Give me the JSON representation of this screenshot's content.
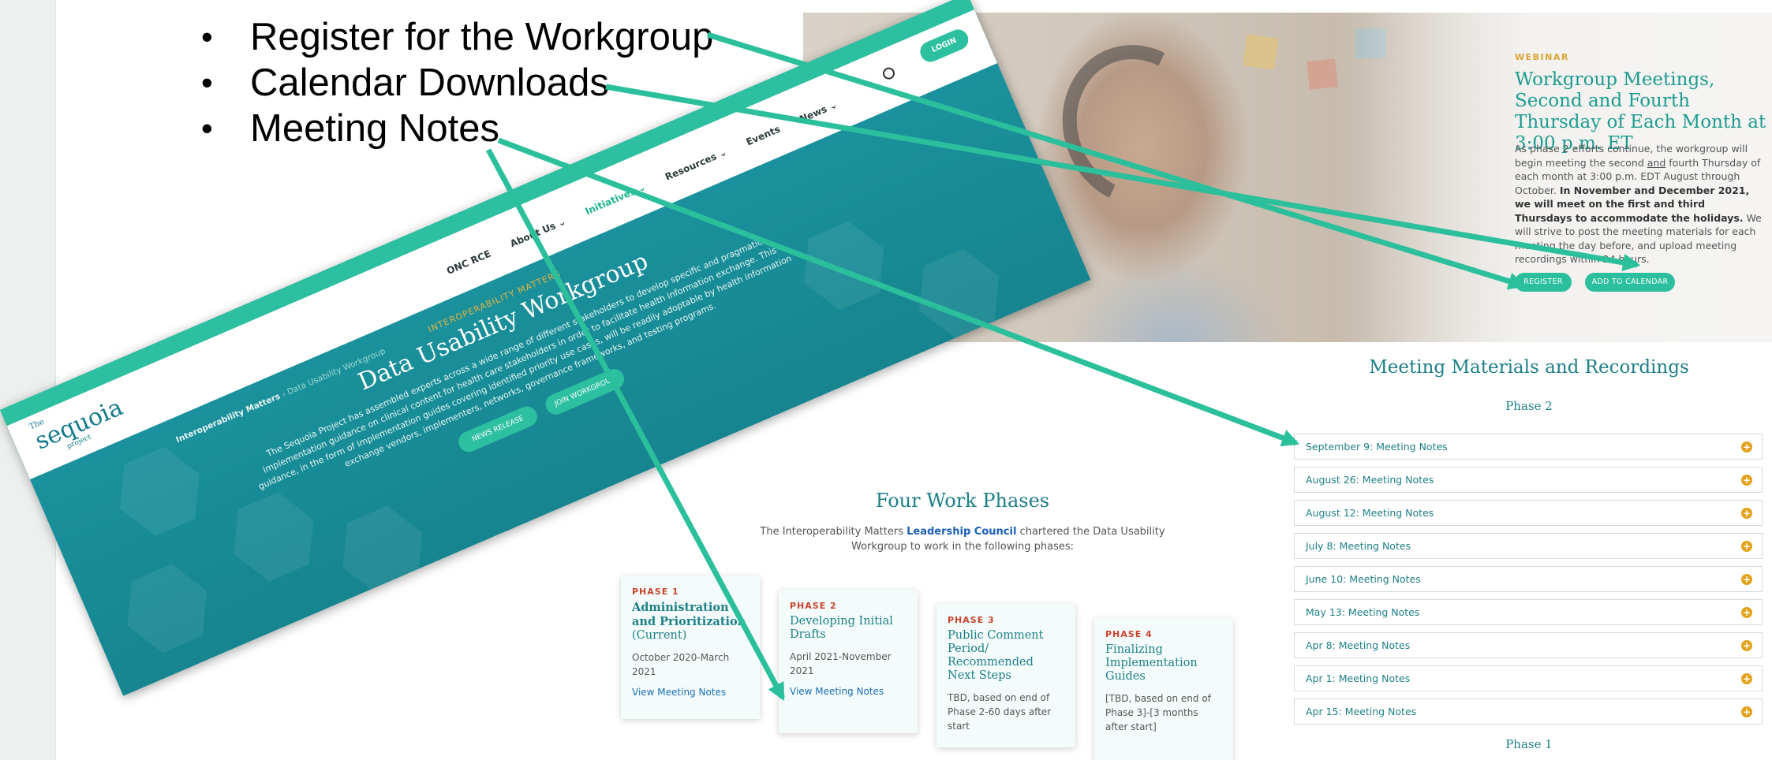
{
  "bullets": [
    "Register for the Workgroup",
    "Calendar Downloads",
    "Meeting Notes"
  ],
  "bullet_symbol": "•",
  "webinar": {
    "kicker": "WEBINAR",
    "title": "Workgroup Meetings, Second and Fourth Thursday of Each Month at 3:00 p.m. ET",
    "body_1": "As phase 2 efforts continue, the workgroup will begin meeting the second ",
    "body_and": "and",
    "body_2": " fourth Thursday of each month at 3:00 p.m. EDT August through October. ",
    "body_bold": "In November and December 2021, we will meet on the first and third Thursdays to accommodate the holidays.",
    "body_3": " We will strive to post the meeting materials for each meeting the day before, and upload meeting recordings within 24 hours.",
    "register_label": "REGISTER",
    "calendar_label": "ADD TO CALENDAR"
  },
  "materials": {
    "title": "Meeting Materials and Recordings",
    "phase2_label": "Phase 2",
    "phase1_label": "Phase 1",
    "items": [
      "September 9: Meeting Notes",
      "August 26: Meeting Notes",
      "August 12: Meeting Notes",
      "July 8: Meeting Notes",
      "June 10: Meeting Notes",
      "May 13: Meeting Notes",
      "Apr 8: Meeting Notes",
      "Apr 1: Meeting Notes",
      "Apr 15: Meeting Notes"
    ],
    "expand_symbol": "+",
    "accent_color": "#e3a21b"
  },
  "work_phases": {
    "title": "Four Work Phases",
    "intro_1": "The Interoperability Matters ",
    "intro_link": "Leadership Council",
    "intro_2": " chartered the Data Usability Workgroup to work in the following phases:",
    "phases": [
      {
        "kicker": "PHASE 1",
        "title": "Administration and Prioritization",
        "status": "(Current)",
        "dates": "October 2020-March 2021",
        "link": "View Meeting Notes"
      },
      {
        "kicker": "PHASE 2",
        "title": "Developing Initial Drafts",
        "dates": "April 2021-November 2021",
        "link": "View Meeting Notes"
      },
      {
        "kicker": "PHASE 3",
        "title": "Public Comment Period/ Recommended Next Steps",
        "dates": "TBD, based on end of Phase 2-60 days after start"
      },
      {
        "kicker": "PHASE 4",
        "title": "Finalizing Implementation Guides",
        "dates": "[TBD, based on end of Phase 3]-[3 months after start]"
      }
    ]
  },
  "site_screenshot": {
    "logo_small": "The",
    "logo_main": "sequoia",
    "logo_tag": "project",
    "nav": [
      "ONC RCE",
      "About Us ⌄",
      "Initiatives ⌄",
      "Resources ⌄",
      "Events",
      "News ⌄"
    ],
    "login_label": "LOGIN",
    "breadcrumb_root": "Interoperability Matters",
    "breadcrumb_sep": " › ",
    "breadcrumb_current": "Data Usability Workgroup",
    "hero_kicker": "INTEROPERABILITY MATTERS",
    "hero_title": "Data Usability Workgroup",
    "hero_desc": "The Sequoia Project has assembled experts across a wide range of different stakeholders to develop specific and pragmatic implementation guidance on clinical content for health care stakeholders in order to facilitate health information exchange. This guidance, in the form of implementation guides covering identified priority use cases, will be readily adoptable by health information exchange vendors, implementers, networks, governance frameworks, and testing programs.",
    "btn_news": "NEWS RELEASE",
    "btn_join": "JOIN WORKGROUP"
  },
  "colors": {
    "arrow": "#2bbf9c",
    "teal_heading": "#1d7f86",
    "phase_kicker": "#c9432b",
    "link_blue": "#1a6fb8"
  }
}
